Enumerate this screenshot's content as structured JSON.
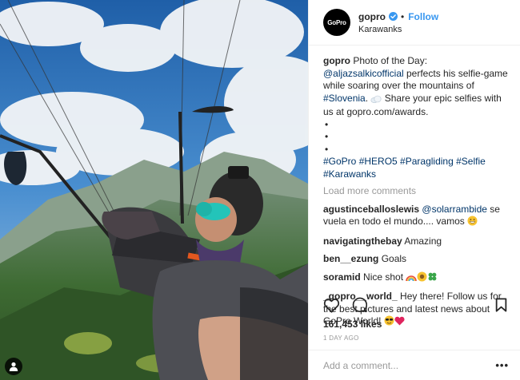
{
  "photo": {
    "alt_name": "paragliding-selfie-photo",
    "user_tag_icon": "user-icon"
  },
  "header": {
    "avatar_text": "GoPro",
    "username": "gopro",
    "verified_icon": "verified-badge-icon",
    "separator": "•",
    "follow_label": "Follow",
    "location": "Karawanks"
  },
  "caption": {
    "username": "gopro",
    "text_1": "Photo of the Day: ",
    "mention": "@aljazsalkicofficial",
    "text_2": " perfects his selfie-game while soaring over the mountains of ",
    "hashtag_location": "#Slovenia",
    "text_3": ". ",
    "emoji_icon": "cloud-emoji-icon",
    "text_4": " Share your epic selfies with us at gopro.com/awards.",
    "bullets": [
      "•",
      "•",
      "•"
    ],
    "hashtags": "#GoPro #HERO5 #Paragliding #Selfie #Karawanks"
  },
  "load_more": "Load more comments",
  "comments": [
    {
      "username": "agustinceballoslewis",
      "mention": "@solarrambide",
      "text": " se vuela en todo el mundo.... vamos ",
      "emoji": "grin-emoji-icon"
    },
    {
      "username": "navigatingthebay",
      "text": "Amazing"
    },
    {
      "username": "ben__ezung",
      "text": "Goals"
    },
    {
      "username": "soramid",
      "text": "Nice shot ",
      "emojis": [
        "rainbow-emoji-icon",
        "sunflower-emoji-icon",
        "clover-emoji-icon"
      ]
    },
    {
      "username": "_gopro__world_",
      "text": "Hey there! Follow us for the best pictures and latest news about GoPro World! ",
      "emojis": [
        "sunglasses-emoji-icon",
        "heart-emoji-icon"
      ]
    }
  ],
  "actions": {
    "like_icon": "heart-icon",
    "comment_icon": "comment-icon",
    "save_icon": "bookmark-icon"
  },
  "likes": "161,453 likes",
  "timestamp": "1 DAY AGO",
  "add_comment": {
    "placeholder": "Add a comment...",
    "more_icon": "more-options-icon",
    "more_label": "•••"
  },
  "colors": {
    "link": "#003569",
    "follow": "#3897f0",
    "muted": "#999999",
    "border": "#efefef"
  }
}
